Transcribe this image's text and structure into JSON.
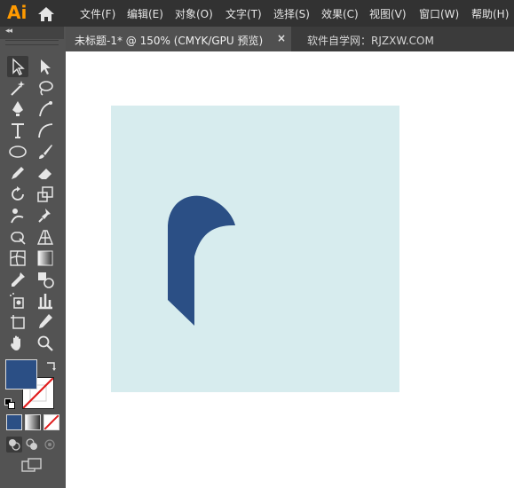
{
  "app": {
    "logo": "Ai"
  },
  "menu": {
    "items": [
      {
        "label": "文件(F)"
      },
      {
        "label": "编辑(E)"
      },
      {
        "label": "对象(O)"
      },
      {
        "label": "文字(T)"
      },
      {
        "label": "选择(S)"
      },
      {
        "label": "效果(C)"
      },
      {
        "label": "视图(V)"
      },
      {
        "label": "窗口(W)"
      },
      {
        "label": "帮助(H)"
      }
    ]
  },
  "tabs": {
    "active": {
      "title": "未标题-1* @ 150% (CMYK/GPU 预览)",
      "close": "×"
    },
    "inactive": {
      "title": "软件自学网：RJZXW.COM"
    }
  },
  "toolbox": {
    "collapse": "◂◂",
    "tools": [
      "selection-tool",
      "direct-selection-tool",
      "magic-wand-tool",
      "lasso-tool",
      "pen-tool",
      "curvature-tool",
      "type-tool",
      "arc-tool",
      "ellipse-tool",
      "paintbrush-tool",
      "pencil-tool",
      "eraser-tool",
      "rotate-tool",
      "scale-tool",
      "puppet-warp-tool",
      "pin-tool",
      "free-transform-tool",
      "perspective-grid-tool",
      "mesh-tool",
      "gradient-tool",
      "eyedropper-tool",
      "blend-tool",
      "symbol-sprayer-tool",
      "column-graph-tool",
      "artboard-tool",
      "slice-tool",
      "hand-tool",
      "zoom-tool"
    ]
  },
  "colors": {
    "fill": "#2B4F85",
    "stroke": "none",
    "artboard": "#D7ECEE",
    "accent_logo": "#FF9A00"
  }
}
